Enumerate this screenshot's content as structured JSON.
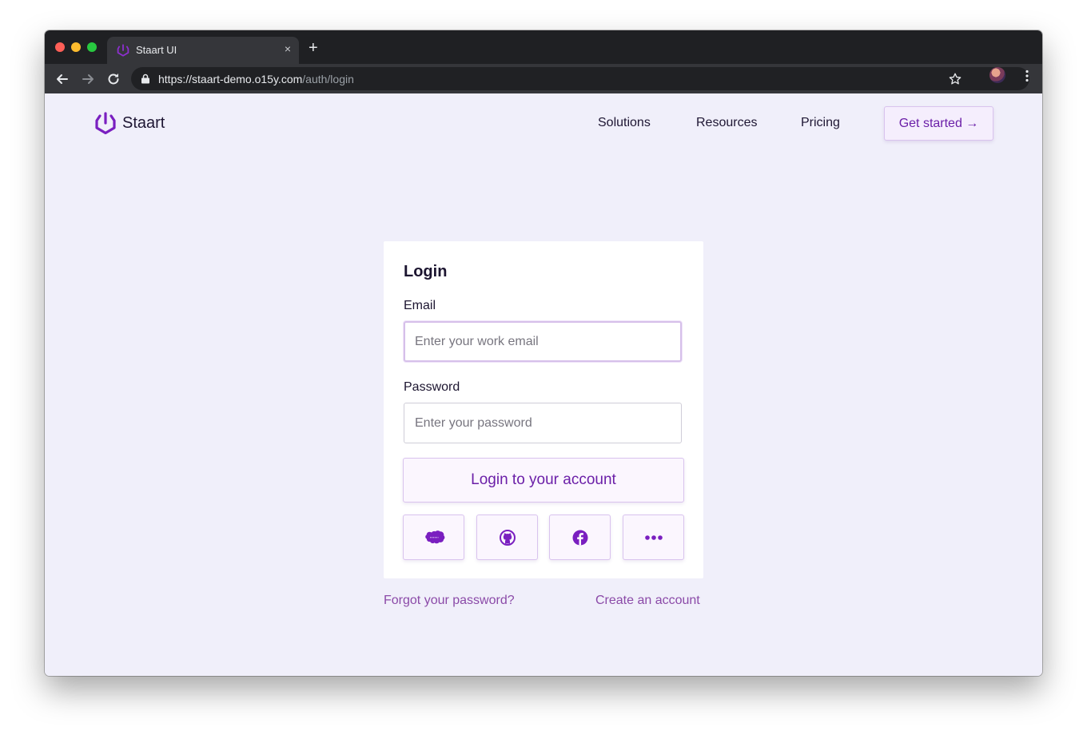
{
  "browser": {
    "tab_title": "Staart UI",
    "close_glyph": "×",
    "new_tab_glyph": "+",
    "url_main": "https://staart-demo.o15y.com",
    "url_path": "/auth/login"
  },
  "header": {
    "brand": "Staart",
    "nav": [
      "Solutions",
      "Resources",
      "Pricing"
    ],
    "cta": "Get started →"
  },
  "login": {
    "title": "Login",
    "email_label": "Email",
    "email_placeholder": "Enter your work email",
    "password_label": "Password",
    "password_placeholder": "Enter your password",
    "submit": "Login to your account",
    "social": [
      "salesforce-icon",
      "github-icon",
      "facebook-icon",
      "more-icon"
    ]
  },
  "footer_links": {
    "forgot": "Forgot your password?",
    "create": "Create an account"
  },
  "colors": {
    "accent": "#6b1fa8",
    "page_background": "#f0effa",
    "link": "#8b4aa8"
  }
}
